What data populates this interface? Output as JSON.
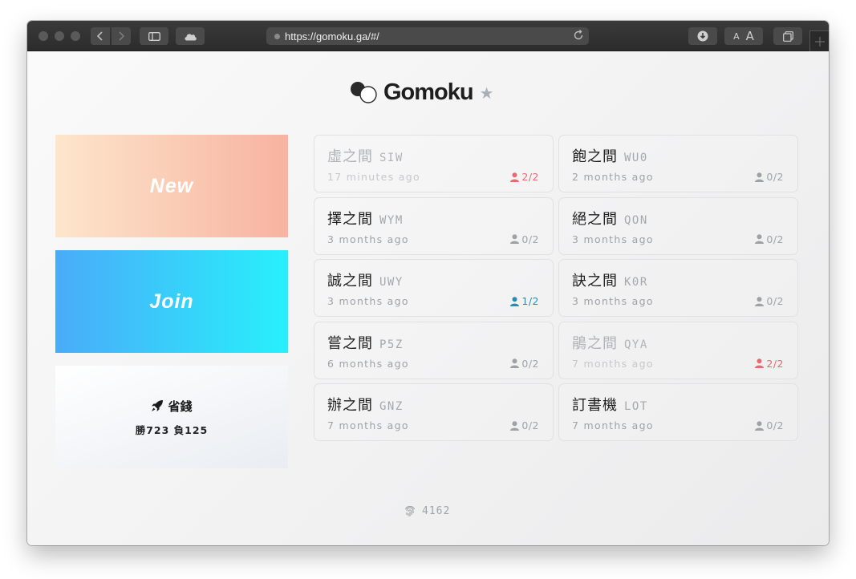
{
  "browser": {
    "url": "https://gomoku.ga/#/"
  },
  "header": {
    "title": "Gomoku"
  },
  "actions": {
    "new_label": "New",
    "join_label": "Join"
  },
  "profile": {
    "name": "省錢",
    "stats": "勝723 負125"
  },
  "rooms": [
    {
      "name": "虛之間",
      "code": "SIW",
      "time": "17 minutes ago",
      "count": "2/2",
      "state": "full"
    },
    {
      "name": "飽之間",
      "code": "WU0",
      "time": "2 months ago",
      "count": "0/2",
      "state": "empty"
    },
    {
      "name": "擇之間",
      "code": "WYM",
      "time": "3 months ago",
      "count": "0/2",
      "state": "empty"
    },
    {
      "name": "絕之間",
      "code": "QON",
      "time": "3 months ago",
      "count": "0/2",
      "state": "empty"
    },
    {
      "name": "誠之間",
      "code": "UWY",
      "time": "3 months ago",
      "count": "1/2",
      "state": "active"
    },
    {
      "name": "訣之間",
      "code": "K0R",
      "time": "3 months ago",
      "count": "0/2",
      "state": "empty"
    },
    {
      "name": "嘗之間",
      "code": "P5Z",
      "time": "6 months ago",
      "count": "0/2",
      "state": "empty"
    },
    {
      "name": "鵑之間",
      "code": "QYA",
      "time": "7 months ago",
      "count": "2/2",
      "state": "full"
    },
    {
      "name": "辦之間",
      "code": "GNZ",
      "time": "7 months ago",
      "count": "0/2",
      "state": "empty"
    },
    {
      "name": "訂書機",
      "code": "LOT",
      "time": "7 months ago",
      "count": "0/2",
      "state": "empty"
    }
  ],
  "footer": {
    "online_count": "4162"
  },
  "colors": {
    "full": "#e46b73",
    "active": "#1f8fb8",
    "empty": "#9ea2a7"
  }
}
